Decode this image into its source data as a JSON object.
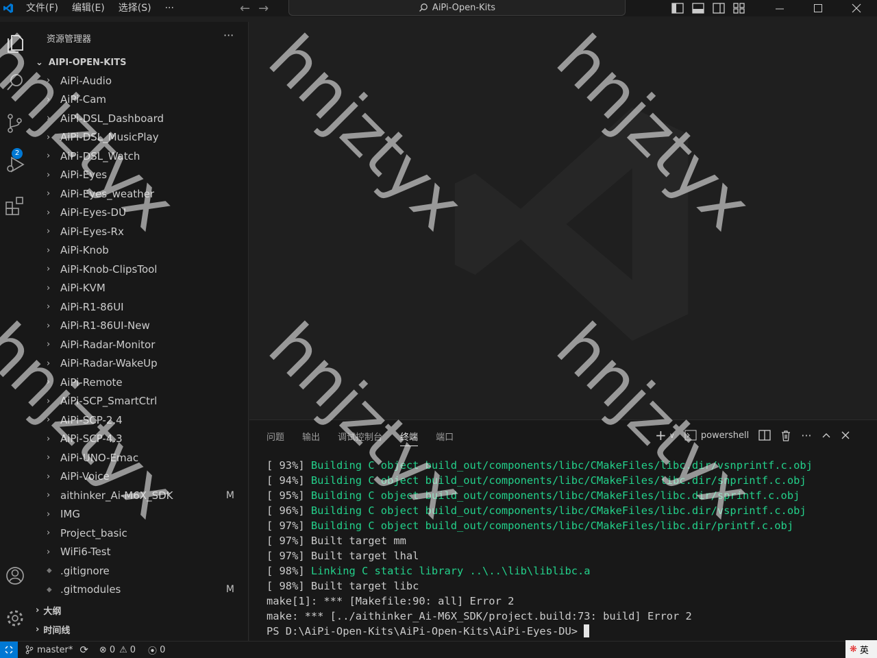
{
  "menu": [
    "文件(F)",
    "编辑(E)",
    "选择(S)",
    "···"
  ],
  "search": {
    "text": "AiPi-Open-Kits"
  },
  "explorer": {
    "title": "资源管理器",
    "more": "···",
    "root": "AIPI-OPEN-KITS",
    "items": [
      {
        "label": "AiPi-Audio",
        "type": "folder",
        "git": ""
      },
      {
        "label": "AiPi-Cam",
        "type": "folder",
        "git": ""
      },
      {
        "label": "AiPi-DSL_Dashboard",
        "type": "folder",
        "git": ""
      },
      {
        "label": "AiPi-DSL_MusicPlay",
        "type": "folder",
        "git": ""
      },
      {
        "label": "AiPi-DSL_Watch",
        "type": "folder",
        "git": ""
      },
      {
        "label": "AiPi-Eyes",
        "type": "folder",
        "git": ""
      },
      {
        "label": "AiPi-Eyes_weather",
        "type": "folder",
        "git": ""
      },
      {
        "label": "AiPi-Eyes-DU",
        "type": "folder",
        "git": ""
      },
      {
        "label": "AiPi-Eyes-Rx",
        "type": "folder",
        "git": ""
      },
      {
        "label": "AiPi-Knob",
        "type": "folder",
        "git": ""
      },
      {
        "label": "AiPi-Knob-ClipsTool",
        "type": "folder",
        "git": ""
      },
      {
        "label": "AiPi-KVM",
        "type": "folder",
        "git": ""
      },
      {
        "label": "AiPi-R1-86UI",
        "type": "folder",
        "git": ""
      },
      {
        "label": "AiPi-R1-86UI-New",
        "type": "folder",
        "git": ""
      },
      {
        "label": "AiPi-Radar-Monitor",
        "type": "folder",
        "git": ""
      },
      {
        "label": "AiPi-Radar-WakeUp",
        "type": "folder",
        "git": ""
      },
      {
        "label": "AiPi-Remote",
        "type": "folder",
        "git": ""
      },
      {
        "label": "AiPi-SCP_SmartCtrl",
        "type": "folder",
        "git": ""
      },
      {
        "label": "AiPi-SCP-2.4",
        "type": "folder",
        "git": ""
      },
      {
        "label": "AiPi-SCP-4.3",
        "type": "folder",
        "git": ""
      },
      {
        "label": "AiPi-UNO-Emac",
        "type": "folder",
        "git": ""
      },
      {
        "label": "AiPi-Voice",
        "type": "folder",
        "git": ""
      },
      {
        "label": "aithinker_Ai-M6X_SDK",
        "type": "folder",
        "git": "M"
      },
      {
        "label": "IMG",
        "type": "folder",
        "git": ""
      },
      {
        "label": "Project_basic",
        "type": "folder",
        "git": ""
      },
      {
        "label": "WiFi6-Test",
        "type": "folder",
        "git": ""
      },
      {
        "label": ".gitignore",
        "type": "file",
        "git": ""
      },
      {
        "label": ".gitmodules",
        "type": "file",
        "git": "M"
      }
    ],
    "sections": [
      "大纲",
      "时间线"
    ]
  },
  "scm_badge": "2",
  "panel": {
    "tabs": [
      "问题",
      "输出",
      "调试控制台",
      "终端",
      "端口"
    ],
    "active_tab": "终端",
    "shell": "powershell"
  },
  "terminal": {
    "lines": [
      {
        "prefix": "[ 93%] ",
        "text": "Building C object build_out/components/libc/CMakeFiles/libc.dir/vsnprintf.c.obj",
        "green": true
      },
      {
        "prefix": "[ 94%] ",
        "text": "Building C object build_out/components/libc/CMakeFiles/libc.dir/snprintf.c.obj",
        "green": true
      },
      {
        "prefix": "[ 95%] ",
        "text": "Building C object build_out/components/libc/CMakeFiles/libc.dir/sprintf.c.obj",
        "green": true
      },
      {
        "prefix": "[ 96%] ",
        "text": "Building C object build_out/components/libc/CMakeFiles/libc.dir/vsprintf.c.obj",
        "green": true
      },
      {
        "prefix": "[ 97%] ",
        "text": "Building C object build_out/components/libc/CMakeFiles/libc.dir/printf.c.obj",
        "green": true
      },
      {
        "prefix": "[ 97%] ",
        "text": "Built target mm",
        "green": false
      },
      {
        "prefix": "[ 97%] ",
        "text": "Built target lhal",
        "green": false
      },
      {
        "prefix": "[ 98%] ",
        "text": "Linking C static library ..\\..\\lib\\liblibc.a",
        "green": true
      },
      {
        "prefix": "[ 98%] ",
        "text": "Built target libc",
        "green": false
      },
      {
        "prefix": "",
        "text": "make[1]: *** [Makefile:90: all] Error 2",
        "green": false
      },
      {
        "prefix": "",
        "text": "make: *** [../aithinker_Ai-M6X_SDK/project.build:73: build] Error 2",
        "green": false
      },
      {
        "prefix": "",
        "text": "PS D:\\AiPi-Open-Kits\\AiPi-Open-Kits\\AiPi-Eyes-DU> ",
        "green": false
      }
    ]
  },
  "status": {
    "branch": "master*",
    "errors": "0",
    "warnings": "0",
    "ports": "0",
    "ime": "英"
  },
  "watermark": "hnjztyx",
  "colors": {
    "accent": "#0078d4",
    "terminal_green": "#23d18b",
    "background": "#1f1f1f",
    "sidebar": "#181818"
  }
}
